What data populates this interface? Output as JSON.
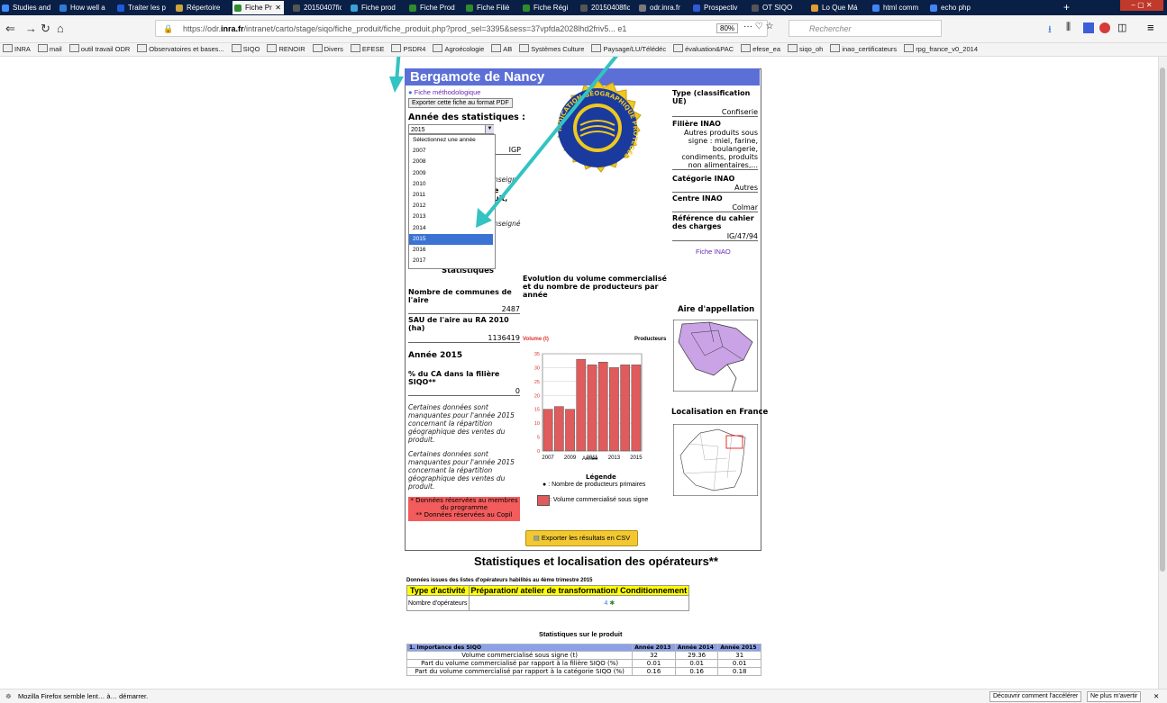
{
  "browser": {
    "tabs": [
      {
        "label": "Studies and",
        "color": "#3f8cff"
      },
      {
        "label": "How well a",
        "color": "#2e7bd6"
      },
      {
        "label": "Traiter les p",
        "color": "#1e5bd6"
      },
      {
        "label": "Répertoire",
        "color": "#caa33d"
      },
      {
        "label": "Fiche Pr",
        "color": "#2e8b2e",
        "active": true
      },
      {
        "label": "20150407fiche_",
        "color": "#555"
      },
      {
        "label": "Fiche prod",
        "color": "#3aa0d8"
      },
      {
        "label": "Fiche Prod",
        "color": "#2e8b2e"
      },
      {
        "label": "Fiche Filiè",
        "color": "#2e8b2e"
      },
      {
        "label": "Fiche Régi",
        "color": "#2e8b2e"
      },
      {
        "label": "20150408fiche",
        "color": "#555"
      },
      {
        "label": "odr.inra.fr",
        "color": "#7a7a7a"
      },
      {
        "label": "Prospectiv",
        "color": "#2e5bd6"
      },
      {
        "label": "OT SIQO",
        "color": "#555"
      },
      {
        "label": "Lo Que Má",
        "color": "#e0a030"
      },
      {
        "label": "html comm",
        "color": "#4285f4"
      },
      {
        "label": "echo php",
        "color": "#4285f4"
      }
    ],
    "url_prefix": "https://odr.",
    "url_domain": "inra.fr",
    "url_rest": "/intranet/carto/stage/siqo/fiche_produit/fiche_produit.php?prod_sel=3395&sess=37vpfda2028lhd2friv5... e1",
    "zoom": "80%",
    "search_placeholder": "Rechercher",
    "bookmarks": [
      "INRA",
      "mail",
      "outil travail ODR",
      "Observatoires et bases...",
      "SIQO",
      "RENOIR",
      "Divers",
      "EFESE",
      "PSDR4",
      "Agroécologie",
      "AB",
      "Systèmes Culture",
      "Paysage/LU/Télédéc",
      "évaluation&PAC",
      "efese_ea",
      "siqo_oh",
      "inao_certificateurs",
      "rpg_france_v0_2014"
    ],
    "status_text": "Mozilla Firefox semble lent… à… démarrer.",
    "status_btn1": "Découvrir comment l'accélérer",
    "status_btn2": "Ne plus m'avertir"
  },
  "product": {
    "title": "Bergamote de Nancy",
    "fiche_method": "Fiche méthodologique",
    "export_pdf": "Exporter cette fiche au format PDF",
    "annee_label": "Année des statistiques :",
    "selected_year": "2015",
    "year_options": [
      "Sélectionnez une année",
      "2007",
      "2008",
      "2009",
      "2010",
      "2011",
      "2012",
      "2013",
      "2014",
      "2015",
      "2016",
      "2017"
    ],
    "partial_igp": "IGP",
    "partial_nseign1": "nseign",
    "partial_e": "e",
    "partial_uit": "uit,",
    "partial_nseign2": "nseigné",
    "seal_text": "INDICATION GÉOGRAPHIQUE PROTÉGÉE",
    "type_label": "Type (classification UE)",
    "type_value": "Confiserie",
    "filiere_label": "Filière INAO",
    "filiere_value": "Autres produits sous signe : miel, farine, boulangerie, condiments, produits non alimentaires,...",
    "categorie_label": "Catégorie INAO",
    "categorie_value": "Autres",
    "centre_label": "Centre INAO",
    "centre_value": "Colmar",
    "reference_label": "Référence du cahier des charges",
    "reference_value": "IG/47/94",
    "fiche_inao": "Fiche INAO",
    "stats_heading": "Statistiques",
    "communes_label": "Nombre de communes de l'aire",
    "communes_value": "2487",
    "sau_label": "SAU de l'aire au RA 2010 (ha)",
    "sau_value": "1136419",
    "annee_heading": "Année 2015",
    "ca_label": "% du CA dans la filière SIQO**",
    "ca_value": "0",
    "missing1": "Certaines données sont manquantes pour l'année 2015 concernant la répartition géographique des ventes du produit.",
    "missing2": "Certaines données sont manquantes pour l'année 2015 concernant la répartition géographique des ventes du produit.",
    "reserved1": "* Données réservées au membres du programme",
    "reserved2": "** Données réservées au Copil",
    "evolution_title": "Evolution du volume commercialisé et du nombre de producteurs par année",
    "aire_title": "Aire d'appellation",
    "localisation_title": "Localisation en France",
    "legend_title": "Légende",
    "legend_producteurs": ": Nombre de producteurs primaires",
    "legend_volume": ": Volume commercialisé sous signe",
    "export_csv": "Exporter les résultats en CSV"
  },
  "chart_data": {
    "type": "bar",
    "ylabel_left": "Volume (t)",
    "ylabel_right": "Producteurs",
    "xlabel": "Annee",
    "categories": [
      "2007",
      "2008",
      "2009",
      "2010",
      "2011",
      "2012",
      "2013",
      "2014",
      "2015"
    ],
    "tick_labels": [
      "2007",
      "2009",
      "2011",
      "2013",
      "2015"
    ],
    "y_ticks": [
      "0",
      "5",
      "10",
      "15",
      "20",
      "25",
      "30",
      "35"
    ],
    "values": [
      15,
      16,
      15,
      33,
      31,
      32,
      30,
      31,
      31
    ],
    "ylim": [
      0,
      35
    ],
    "bar_color": "#e05b5b"
  },
  "operators": {
    "title": "Statistiques et localisation des opérateurs**",
    "source_note": "Données issues des listes d'opérateurs habilités au 4ème trimestre 2015",
    "header_col1": "Type d'activité",
    "header_col2": "Préparation/ atelier de transformation/ Conditionnement",
    "row_label": "Nombre d'opérateurs",
    "row_value": "4"
  },
  "product_stats": {
    "title": "Statistiques sur le produit",
    "section": "1. Importance des SIQO",
    "years": [
      "Année 2013",
      "Année 2014",
      "Année 2015"
    ],
    "rows": [
      {
        "label": "Volume commercialisé sous signe (t)",
        "values": [
          "32",
          "29.36",
          "31"
        ]
      },
      {
        "label": "Part du volume commercialisé par rapport à la filière SIQO (%)",
        "values": [
          "0.01",
          "0.01",
          "0.01"
        ]
      },
      {
        "label": "Part du volume commercialisé par rapport à la catégorie SIQO (%)",
        "values": [
          "0.16",
          "0.16",
          "0.18"
        ]
      }
    ]
  }
}
